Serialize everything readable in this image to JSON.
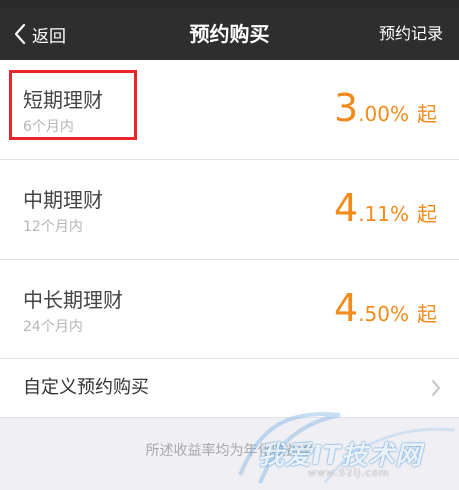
{
  "nav": {
    "back_label": "返回",
    "title": "预约购买",
    "right_link": "预约记录"
  },
  "products": [
    {
      "name": "短期理财",
      "term": "6个月内",
      "rate_int": "3",
      "rate_dec": ".00%",
      "rate_suffix": "起"
    },
    {
      "name": "中期理财",
      "term": "12个月内",
      "rate_int": "4",
      "rate_dec": ".11%",
      "rate_suffix": "起"
    },
    {
      "name": "中长期理财",
      "term": "24个月内",
      "rate_int": "4",
      "rate_dec": ".50%",
      "rate_suffix": "起"
    }
  ],
  "custom": {
    "label": "自定义预约购买"
  },
  "footer": {
    "note": "所述收益率均为年化收益率"
  },
  "watermark": {
    "text": "我爱IT技术网",
    "url": "www.52ij.com"
  },
  "colors": {
    "accent": "#f08b1c",
    "navbar": "#2e2e2e",
    "highlight": "#e8262a"
  }
}
